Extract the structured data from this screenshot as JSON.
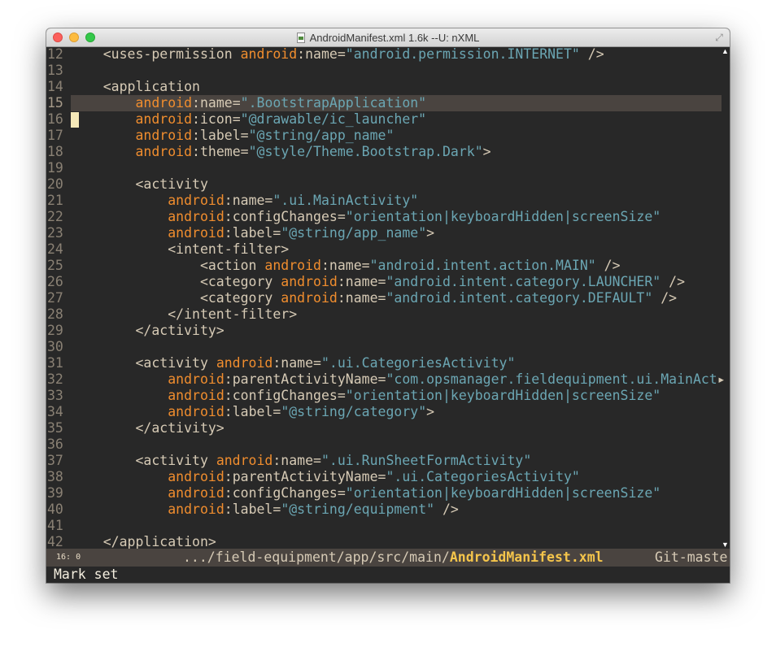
{
  "window": {
    "title": "AndroidManifest.xml 1.6k --U: nXML",
    "file_icon": "xml-file-icon",
    "fullscreen_icon": "fullscreen-icon"
  },
  "colors": {
    "background": "#282828",
    "text": "#d6cab5",
    "namespace": "#f08d2e",
    "string": "#6ba6b3",
    "line_number": "#8a8174",
    "current_line": "#4a4440",
    "modeline_bg": "#4a4440",
    "modeline_filename": "#f5c54b"
  },
  "editor": {
    "current_line": 15,
    "cursor_line": 16,
    "lines": [
      {
        "n": "12",
        "segments": [
          [
            "t",
            "    <uses-permission "
          ],
          [
            "ns",
            "android"
          ],
          [
            "t",
            ":name="
          ],
          [
            "str",
            "\"android.permission.INTERNET\""
          ],
          [
            "t",
            " />"
          ]
        ]
      },
      {
        "n": "13",
        "segments": []
      },
      {
        "n": "14",
        "segments": [
          [
            "t",
            "    <application"
          ]
        ]
      },
      {
        "n": "15",
        "segments": [
          [
            "t",
            "        "
          ],
          [
            "ns",
            "android"
          ],
          [
            "t",
            ":name="
          ],
          [
            "str",
            "\".BootstrapApplication\""
          ]
        ]
      },
      {
        "n": "16",
        "segments": [
          [
            "t",
            "        "
          ],
          [
            "ns",
            "android"
          ],
          [
            "t",
            ":icon="
          ],
          [
            "str",
            "\"@drawable/ic_launcher\""
          ]
        ]
      },
      {
        "n": "17",
        "segments": [
          [
            "t",
            "        "
          ],
          [
            "ns",
            "android"
          ],
          [
            "t",
            ":label="
          ],
          [
            "str",
            "\"@string/app_name\""
          ]
        ]
      },
      {
        "n": "18",
        "segments": [
          [
            "t",
            "        "
          ],
          [
            "ns",
            "android"
          ],
          [
            "t",
            ":theme="
          ],
          [
            "str",
            "\"@style/Theme.Bootstrap.Dark\""
          ],
          [
            "t",
            ">"
          ]
        ]
      },
      {
        "n": "19",
        "segments": []
      },
      {
        "n": "20",
        "segments": [
          [
            "t",
            "        <activity"
          ]
        ]
      },
      {
        "n": "21",
        "segments": [
          [
            "t",
            "            "
          ],
          [
            "ns",
            "android"
          ],
          [
            "t",
            ":name="
          ],
          [
            "str",
            "\".ui.MainActivity\""
          ]
        ]
      },
      {
        "n": "22",
        "segments": [
          [
            "t",
            "            "
          ],
          [
            "ns",
            "android"
          ],
          [
            "t",
            ":configChanges="
          ],
          [
            "str",
            "\"orientation|keyboardHidden|screenSize\""
          ]
        ]
      },
      {
        "n": "23",
        "segments": [
          [
            "t",
            "            "
          ],
          [
            "ns",
            "android"
          ],
          [
            "t",
            ":label="
          ],
          [
            "str",
            "\"@string/app_name\""
          ],
          [
            "t",
            ">"
          ]
        ]
      },
      {
        "n": "24",
        "segments": [
          [
            "t",
            "            <intent-filter>"
          ]
        ]
      },
      {
        "n": "25",
        "segments": [
          [
            "t",
            "                <action "
          ],
          [
            "ns",
            "android"
          ],
          [
            "t",
            ":name="
          ],
          [
            "str",
            "\"android.intent.action.MAIN\""
          ],
          [
            "t",
            " />"
          ]
        ]
      },
      {
        "n": "26",
        "segments": [
          [
            "t",
            "                <category "
          ],
          [
            "ns",
            "android"
          ],
          [
            "t",
            ":name="
          ],
          [
            "str",
            "\"android.intent.category.LAUNCHER\""
          ],
          [
            "t",
            " />"
          ]
        ]
      },
      {
        "n": "27",
        "segments": [
          [
            "t",
            "                <category "
          ],
          [
            "ns",
            "android"
          ],
          [
            "t",
            ":name="
          ],
          [
            "str",
            "\"android.intent.category.DEFAULT\""
          ],
          [
            "t",
            " />"
          ]
        ]
      },
      {
        "n": "28",
        "segments": [
          [
            "t",
            "            </intent-filter>"
          ]
        ]
      },
      {
        "n": "29",
        "segments": [
          [
            "t",
            "        </activity>"
          ]
        ]
      },
      {
        "n": "30",
        "segments": []
      },
      {
        "n": "31",
        "segments": [
          [
            "t",
            "        <activity "
          ],
          [
            "ns",
            "android"
          ],
          [
            "t",
            ":name="
          ],
          [
            "str",
            "\".ui.CategoriesActivity\""
          ]
        ]
      },
      {
        "n": "32",
        "segments": [
          [
            "t",
            "            "
          ],
          [
            "ns",
            "android"
          ],
          [
            "t",
            ":parentActivityName="
          ],
          [
            "str",
            "\"com.opsmanager.fieldequipment.ui.MainAct"
          ],
          [
            "t",
            "▸"
          ]
        ]
      },
      {
        "n": "33",
        "segments": [
          [
            "t",
            "            "
          ],
          [
            "ns",
            "android"
          ],
          [
            "t",
            ":configChanges="
          ],
          [
            "str",
            "\"orientation|keyboardHidden|screenSize\""
          ]
        ]
      },
      {
        "n": "34",
        "segments": [
          [
            "t",
            "            "
          ],
          [
            "ns",
            "android"
          ],
          [
            "t",
            ":label="
          ],
          [
            "str",
            "\"@string/category\""
          ],
          [
            "t",
            ">"
          ]
        ]
      },
      {
        "n": "35",
        "segments": [
          [
            "t",
            "        </activity>"
          ]
        ]
      },
      {
        "n": "36",
        "segments": []
      },
      {
        "n": "37",
        "segments": [
          [
            "t",
            "        <activity "
          ],
          [
            "ns",
            "android"
          ],
          [
            "t",
            ":name="
          ],
          [
            "str",
            "\".ui.RunSheetFormActivity\""
          ]
        ]
      },
      {
        "n": "38",
        "segments": [
          [
            "t",
            "            "
          ],
          [
            "ns",
            "android"
          ],
          [
            "t",
            ":parentActivityName="
          ],
          [
            "str",
            "\".ui.CategoriesActivity\""
          ]
        ]
      },
      {
        "n": "39",
        "segments": [
          [
            "t",
            "            "
          ],
          [
            "ns",
            "android"
          ],
          [
            "t",
            ":configChanges="
          ],
          [
            "str",
            "\"orientation|keyboardHidden|screenSize\""
          ]
        ]
      },
      {
        "n": "40",
        "segments": [
          [
            "t",
            "            "
          ],
          [
            "ns",
            "android"
          ],
          [
            "t",
            ":label="
          ],
          [
            "str",
            "\"@string/equipment\""
          ],
          [
            "t",
            " />"
          ]
        ]
      },
      {
        "n": "41",
        "segments": []
      },
      {
        "n": "42",
        "segments": [
          [
            "t",
            "    </application>"
          ]
        ]
      }
    ],
    "scroll_up_icon": "scroll-up-arrow-icon",
    "scroll_down_icon": "scroll-down-arrow-icon"
  },
  "modeline": {
    "position": "16: 0",
    "path_prefix": ".../field-equipment/app/src/main/",
    "filename": "AndroidManifest.xml",
    "vcs": "Git-maste"
  },
  "minibuffer": {
    "message": "Mark set"
  }
}
